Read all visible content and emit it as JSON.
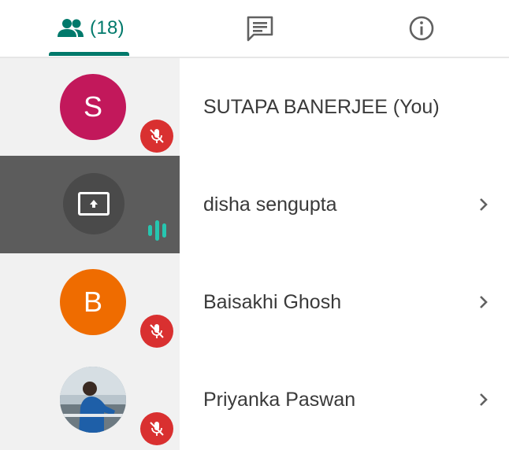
{
  "tabs": {
    "people": {
      "icon": "people-icon",
      "count": "(18)",
      "selected": true
    },
    "chat": {
      "icon": "chat-icon"
    },
    "info": {
      "icon": "info-icon"
    }
  },
  "colors": {
    "accent": "#00796b",
    "mute_badge": "#d93030",
    "speaking": "#26c6b0",
    "active_row": "#5c5c5c"
  },
  "participants": [
    {
      "name": "SUTAPA BANERJEE (You)",
      "avatar_initial": "S",
      "avatar_color": "#c2185b",
      "muted": true,
      "has_chevron": false
    },
    {
      "name": "disha sengupta",
      "avatar_initial": "",
      "avatar_icon": "present-to-all-icon",
      "presenting": true,
      "speaking": true,
      "has_chevron": true
    },
    {
      "name": "Baisakhi Ghosh",
      "avatar_initial": "B",
      "avatar_color": "#ef6c00",
      "muted": true,
      "has_chevron": true
    },
    {
      "name": "Priyanka Paswan",
      "avatar_icon": "profile-photo",
      "muted": true,
      "has_chevron": true
    }
  ]
}
